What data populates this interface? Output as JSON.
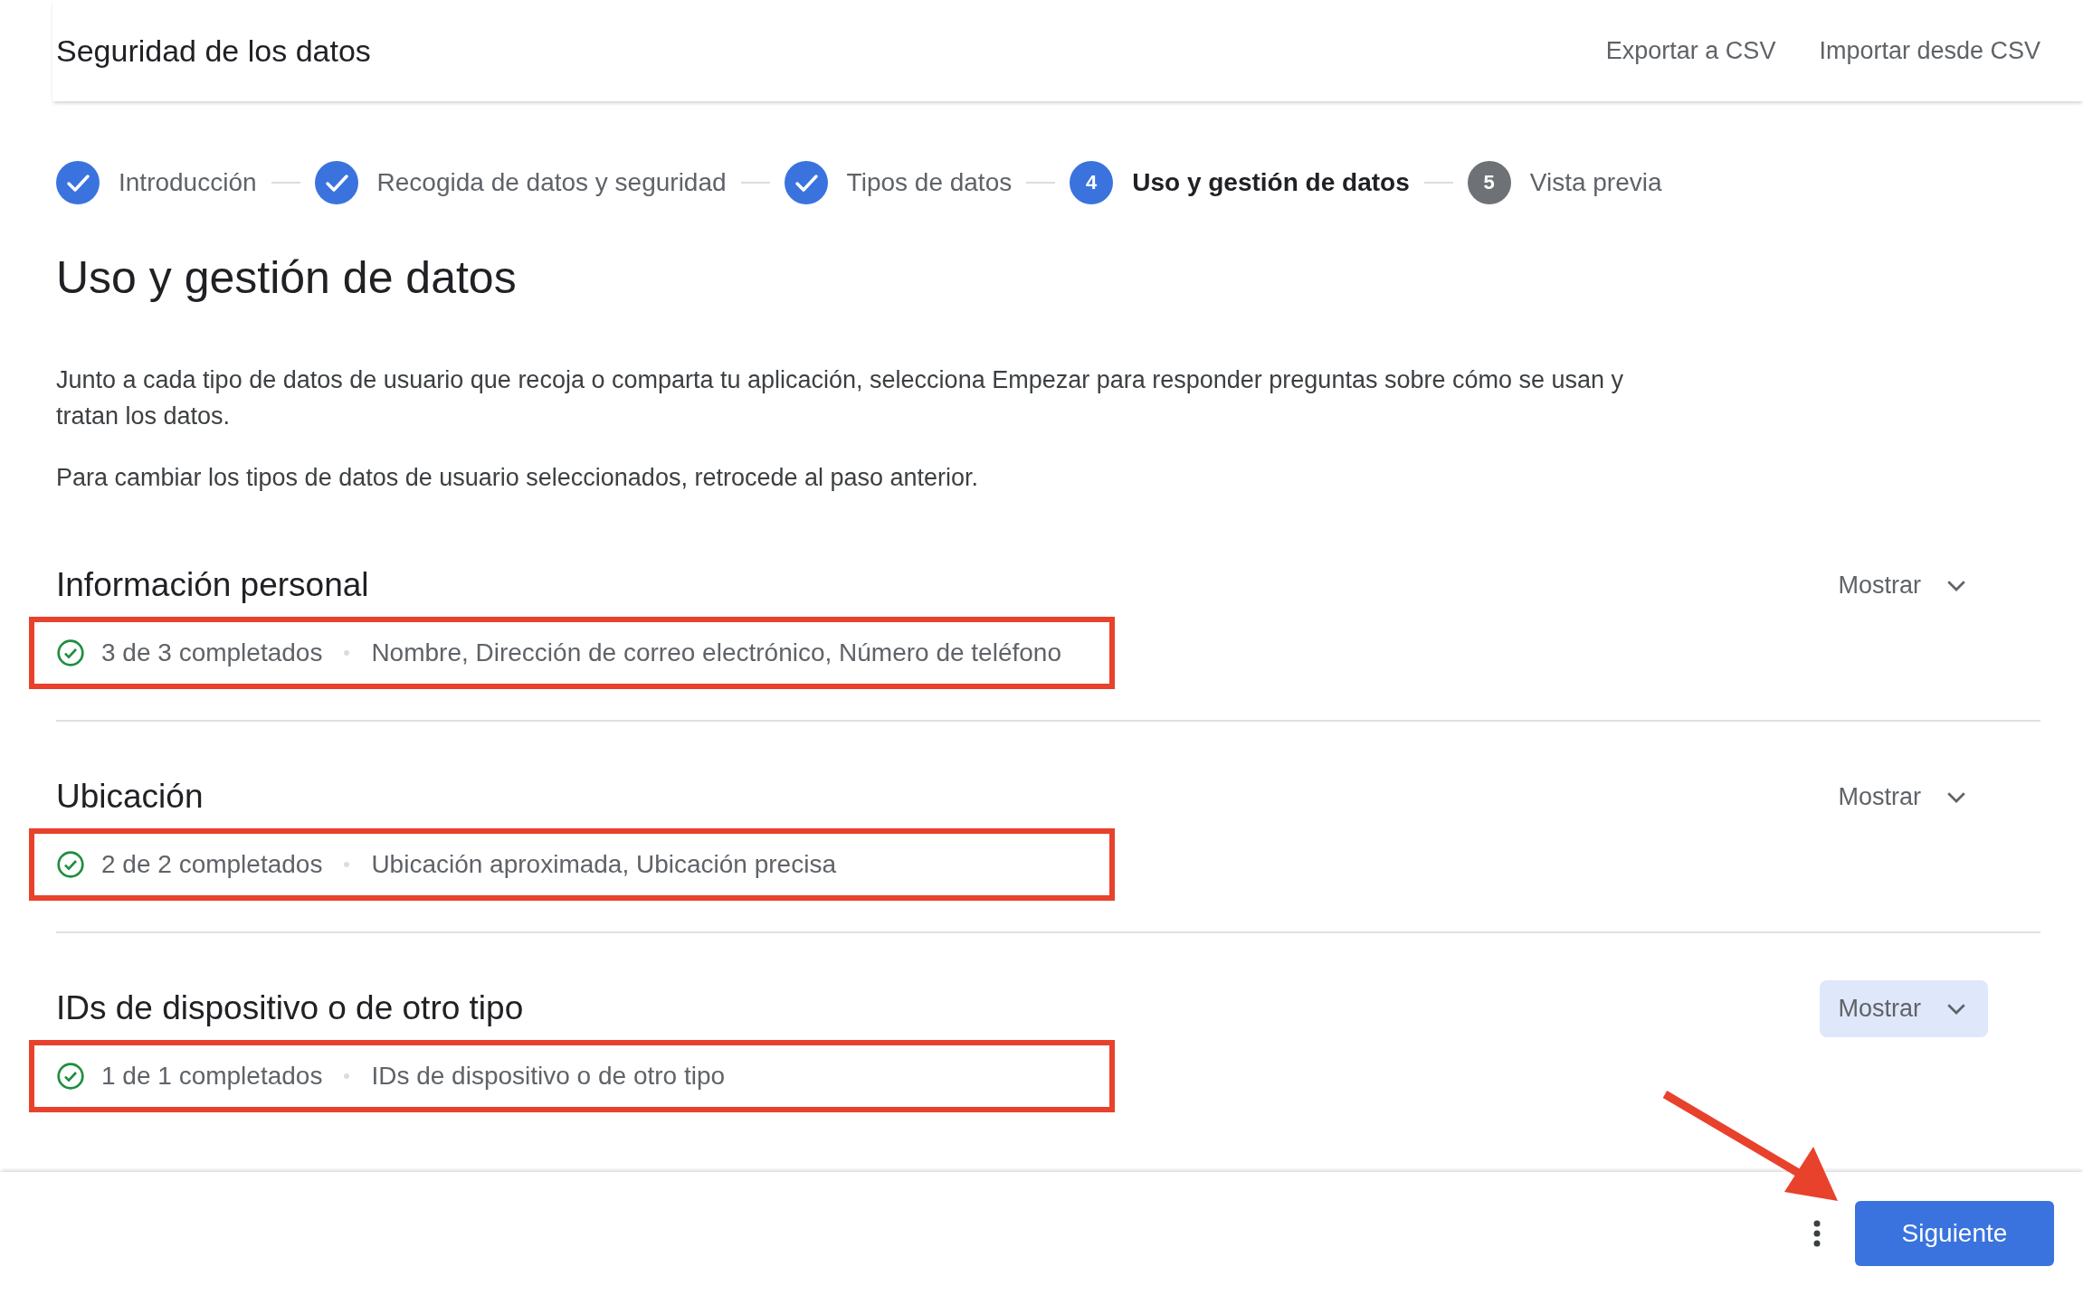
{
  "header": {
    "title": "Seguridad de los datos",
    "actions": [
      "Exportar a CSV",
      "Importar desde CSV"
    ]
  },
  "steps": [
    {
      "label": "Introducción",
      "done": true,
      "selected": false
    },
    {
      "label": "Recogida de datos y seguridad",
      "done": true,
      "selected": false
    },
    {
      "label": "Tipos de datos",
      "done": true,
      "selected": false
    },
    {
      "label": "Uso y gestión de datos",
      "number": "4",
      "done": false,
      "selected": true
    },
    {
      "label": "Vista previa",
      "number": "5",
      "done": false,
      "selected": false
    }
  ],
  "page_title": "Uso y gestión de datos",
  "paragraphs": [
    "Junto a cada tipo de datos de usuario que recoja o comparta tu aplicación, selecciona Empezar para responder preguntas sobre cómo se usan y tratan los datos.",
    "Para cambiar los tipos de datos de usuario seleccionados, retrocede al paso anterior."
  ],
  "sections": [
    {
      "title": "Información personal",
      "progress": "3 de 3 completados",
      "items": "Nombre, Dirección de correo electrónico, Número de teléfono",
      "highlighted": true,
      "toggle": "Mostrar",
      "hovered": false
    },
    {
      "title": "Ubicación",
      "progress": "2 de 2 completados",
      "items": "Ubicación aproximada, Ubicación precisa",
      "highlighted": true,
      "toggle": "Mostrar",
      "hovered": false
    },
    {
      "title": "IDs de dispositivo o de otro tipo",
      "progress": "1 de 1 completados",
      "items": "IDs de dispositivo o de otro tipo",
      "highlighted": true,
      "toggle": "Mostrar",
      "hovered": true
    }
  ],
  "footer": {
    "next_button": "Siguiente",
    "arrow_annotation": true
  }
}
